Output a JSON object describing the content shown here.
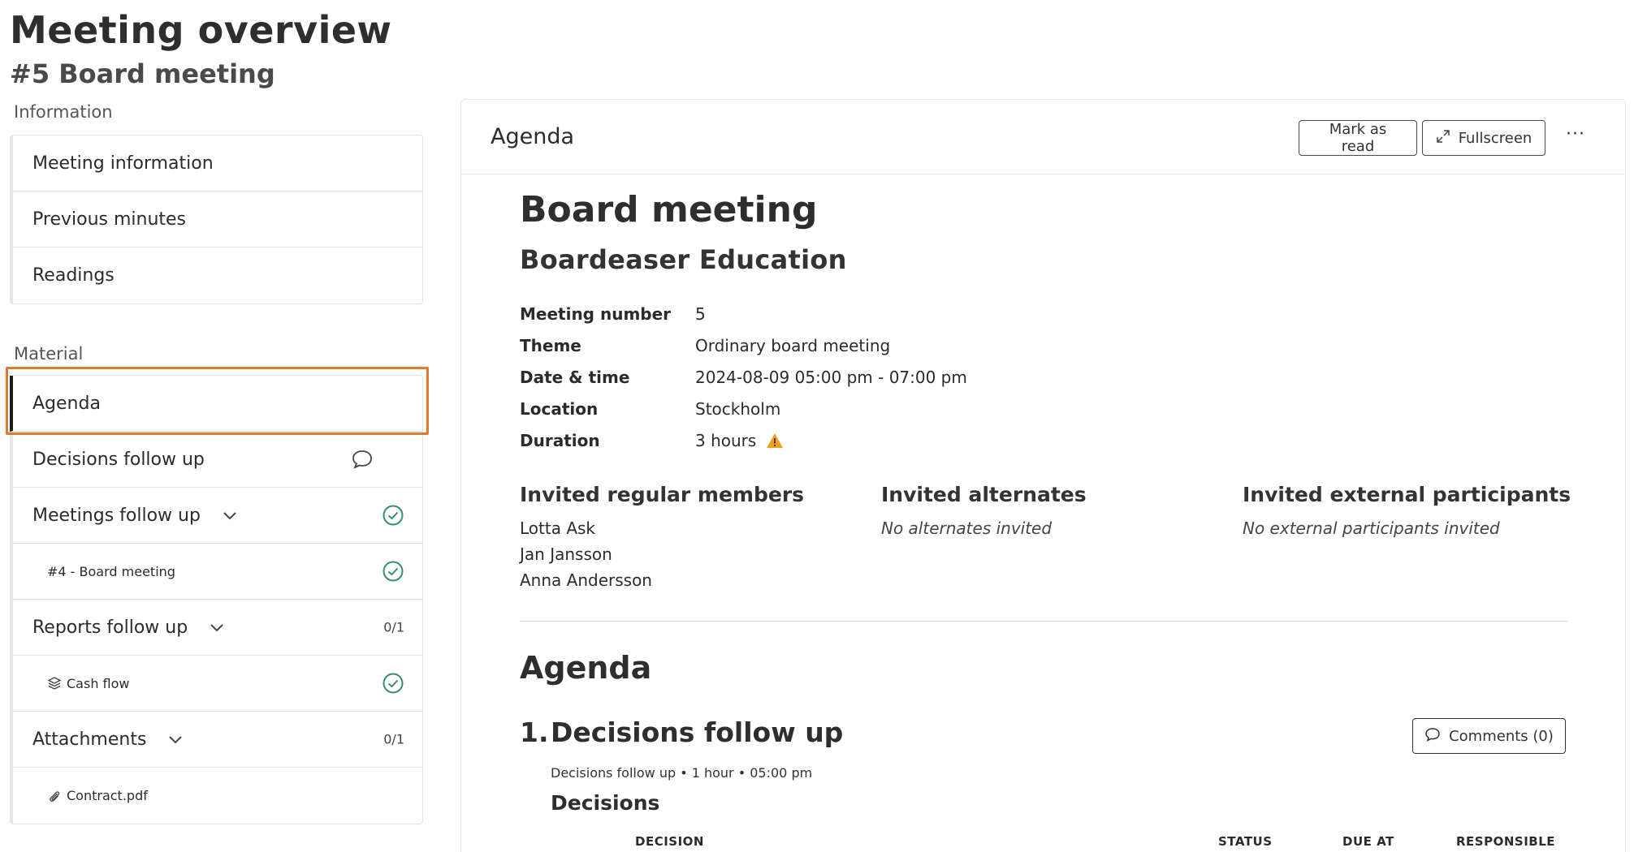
{
  "page": {
    "title": "Meeting overview",
    "subtitle": "#5 Board meeting"
  },
  "sidebar": {
    "information_label": "Information",
    "information_items": [
      "Meeting information",
      "Previous minutes",
      "Readings"
    ],
    "material_label": "Material",
    "material_items": [
      {
        "label": "Agenda",
        "active": true
      },
      {
        "label": "Decisions follow up",
        "icon": "comment-icon"
      },
      {
        "label": "Meetings follow up",
        "expandable": true,
        "status_icon": "check-circle-icon"
      },
      {
        "label": "#4 - Board meeting",
        "sub": true,
        "status_icon": "check-circle-icon"
      },
      {
        "label": "Reports follow up",
        "expandable": true,
        "count": "0/1"
      },
      {
        "label": "Cash flow",
        "sub": true,
        "lead_icon": "layers-icon",
        "status_icon": "check-circle-icon"
      },
      {
        "label": "Attachments",
        "expandable": true,
        "count": "0/1"
      },
      {
        "label": "Contract.pdf",
        "sub": true,
        "lead_icon": "paperclip-icon"
      }
    ]
  },
  "panel": {
    "title": "Agenda",
    "mark_as_read": "Mark as read",
    "fullscreen": "Fullscreen",
    "more": "···"
  },
  "document": {
    "title": "Board meeting",
    "organization": "Boardeaser Education",
    "info": [
      {
        "key": "Meeting number",
        "value": "5"
      },
      {
        "key": "Theme",
        "value": "Ordinary board meeting"
      },
      {
        "key": "Date & time",
        "value": "2024-08-09 05:00 pm - 07:00 pm"
      },
      {
        "key": "Location",
        "value": "Stockholm"
      },
      {
        "key": "Duration",
        "value": "3 hours",
        "warning": true
      }
    ],
    "invited_regular_title": "Invited regular members",
    "invited_regular": [
      "Lotta Ask",
      "Jan Jansson",
      "Anna Andersson"
    ],
    "invited_alternates_title": "Invited alternates",
    "invited_alternates_empty": "No alternates invited",
    "invited_external_title": "Invited external participants",
    "invited_external_empty": "No external participants invited",
    "agenda_heading": "Agenda",
    "agenda_item": {
      "number": "1.",
      "title": "Decisions follow up",
      "comments": "Comments (0)",
      "meta": "Decisions follow up • 1 hour • 05:00 pm",
      "decisions_heading": "Decisions",
      "columns": [
        "DECISION",
        "STATUS",
        "DUE AT",
        "RESPONSIBLE"
      ]
    }
  },
  "colors": {
    "highlight": "#e07a33",
    "success": "#3a8f6b",
    "warning": "#f0a020"
  }
}
